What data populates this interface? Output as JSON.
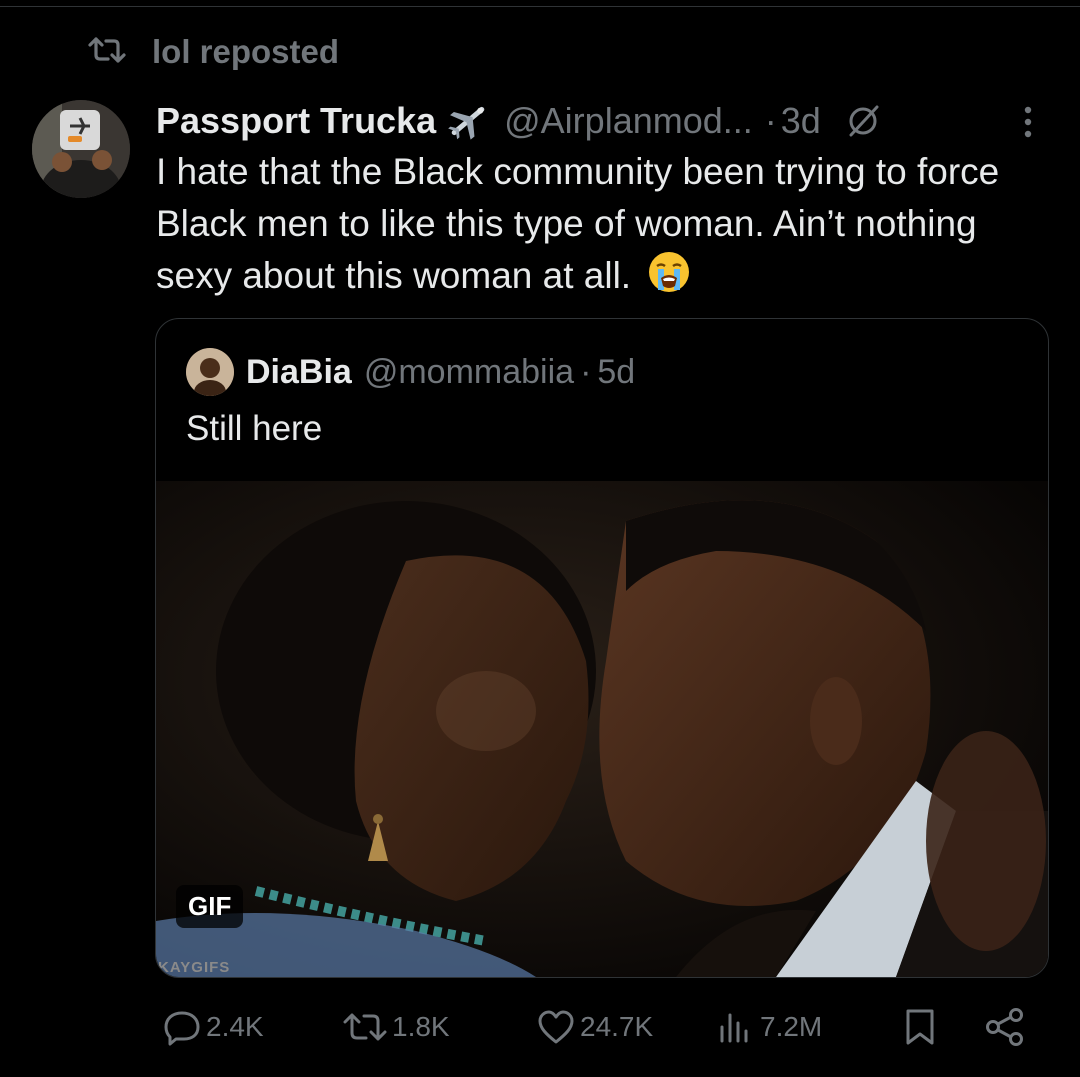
{
  "repost": {
    "label": "lol reposted"
  },
  "tweet": {
    "author_name": "Passport Trucka",
    "author_handle": "@Airplanmod...",
    "separator": "·",
    "time": "3d",
    "text": "I hate that the Black community been trying to force Black men to like this type of woman. Ain’t nothing sexy about this woman at all.",
    "emoji": "loudly-crying-face"
  },
  "quote": {
    "author_name": "DiaBia",
    "author_handle": "@mommabiia",
    "separator": "·",
    "time": "5d",
    "text": "Still here",
    "media_badge": "GIF",
    "watermark": "KAYGIFS"
  },
  "actions": {
    "replies": "2.4K",
    "reposts": "1.8K",
    "likes": "24.7K",
    "views": "7.2M"
  },
  "colors": {
    "background": "#000000",
    "text": "#e7e9ea",
    "muted": "#71767b",
    "border": "#2f3336"
  }
}
